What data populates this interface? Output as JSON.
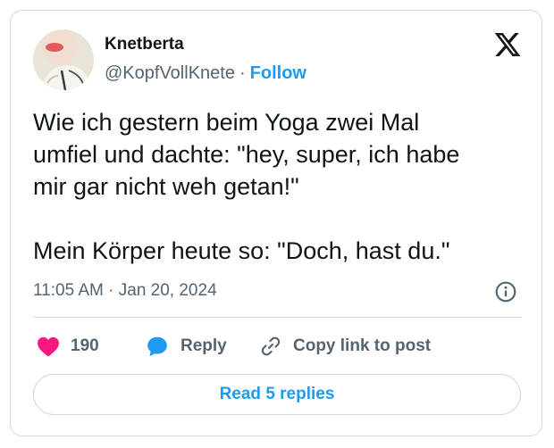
{
  "author": {
    "name": "Knetberta",
    "handle": "@KopfVollKnete",
    "separator": "·",
    "follow_label": "Follow"
  },
  "tweet": {
    "text": "Wie ich gestern beim Yoga zwei Mal\numfiel und dachte: \"hey, super, ich habe\nmir gar nicht weh getan!\"\n\nMein Körper heute so: \"Doch, hast du.\"",
    "time": "11:05 AM",
    "date_separator": "·",
    "date": "Jan 20, 2024"
  },
  "actions": {
    "like_count": "190",
    "reply_label": "Reply",
    "copy_label": "Copy link to post"
  },
  "read_replies_label": "Read 5 replies",
  "colors": {
    "accent": "#1d9bf0",
    "like": "#f91880",
    "text": "#0f1419",
    "muted": "#536471",
    "border": "#cfd9de"
  },
  "icons": {
    "brand": "x-logo-icon",
    "info": "info-icon",
    "like": "heart-icon",
    "reply": "speech-bubble-icon",
    "copy": "link-icon"
  }
}
